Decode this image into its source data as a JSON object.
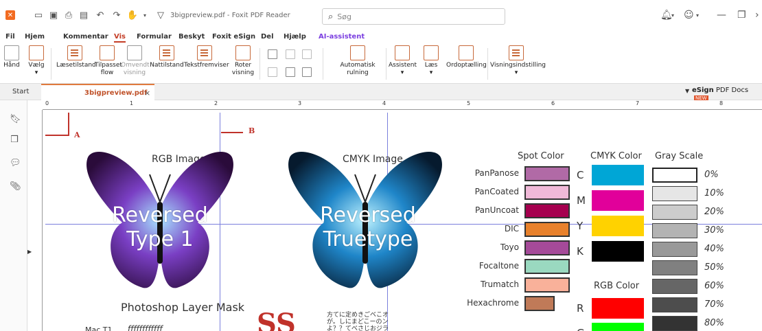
{
  "window": {
    "doc_title": "3bigpreview.pdf - Foxit PDF Reader",
    "search_placeholder": "Søg"
  },
  "menu": {
    "items": [
      "Fil",
      "Hjem",
      "Kommentar",
      "Vis",
      "Formular",
      "Beskyt",
      "Foxit eSign",
      "Del",
      "Hjælp",
      "AI-assistent"
    ],
    "active": "Vis"
  },
  "ribbon": {
    "hand": "Hånd",
    "select": "Vælg",
    "read_mode": "Læsetilstand",
    "fit_flow_1": "Tilpasset",
    "fit_flow_2": "flow",
    "reverse_1": "Omvendt",
    "reverse_2": "visning",
    "night": "Nattilstand",
    "text_viewer": "Tekstfremviser",
    "rotate_1": "Roter",
    "rotate_2": "visning",
    "autoscroll": "Automatisk rulning",
    "assistant": "Assistent",
    "read": "Læs",
    "word_count": "Ordoptælling",
    "view_settings": "Visningsindstilling"
  },
  "tabs": {
    "start": "Start",
    "doc": "3bigpreview.pdf",
    "close": "×",
    "esign_bold": "eSign",
    "esign_rest": "PDF Docs",
    "esign_badge": "NEW"
  },
  "ruler": {
    "h_numbers": [
      "0",
      "1",
      "2",
      "3",
      "4",
      "5",
      "6",
      "7",
      "8"
    ]
  },
  "page": {
    "mark_a": "A",
    "mark_b": "B",
    "rgb_caption": "RGB Image",
    "cmyk_caption": "CMYK Image",
    "bf1_line1": "Reversed",
    "bf1_line2": "Type 1",
    "bf2_line1": "Reversed",
    "bf2_line2": "Truetype",
    "photoshop": "Photoshop Layer Mask",
    "mac_t1": "Mac T1",
    "mac_t1_glyphs": "ƒƒƒƒƒƒƒƒƒƒƒƒ",
    "ss_logo": "SS",
    "cjk_text": "方てに定めきごべこオが。しにまどこーのンよ？？てべさじおジラ"
  },
  "colors": {
    "spot_head": "Spot Color",
    "cmyk_head": "CMYK Color",
    "gray_head": "Gray Scale",
    "rgb_head": "RGB Color",
    "spot": [
      {
        "label": "PanPanose",
        "color": "#b16aa6"
      },
      {
        "label": "PanCoated",
        "color": "#f0b9d8"
      },
      {
        "label": "PanUncoat",
        "color": "#a6004f"
      },
      {
        "label": "DIC",
        "color": "#e8812c"
      },
      {
        "label": "Toyo",
        "color": "#a54a99"
      },
      {
        "label": "Focaltone",
        "color": "#9ad9c0"
      },
      {
        "label": "Trumatch",
        "color": "#f9b19a"
      },
      {
        "label": "Hexachrome",
        "color": "#c07a58"
      }
    ],
    "cmyk": [
      {
        "label": "C",
        "color": "#00a6d6"
      },
      {
        "label": "M",
        "color": "#e1009a"
      },
      {
        "label": "Y",
        "color": "#ffd200"
      },
      {
        "label": "K",
        "color": "#000000"
      }
    ],
    "rgb": [
      {
        "label": "R",
        "color": "#ff0000"
      },
      {
        "label": "G",
        "color": "#00ff00"
      }
    ],
    "gray": [
      {
        "label": "0%",
        "color": "#ffffff"
      },
      {
        "label": "10%",
        "color": "#e6e6e6"
      },
      {
        "label": "20%",
        "color": "#cccccc"
      },
      {
        "label": "30%",
        "color": "#b3b3b3"
      },
      {
        "label": "40%",
        "color": "#999999"
      },
      {
        "label": "50%",
        "color": "#808080"
      },
      {
        "label": "60%",
        "color": "#666666"
      },
      {
        "label": "70%",
        "color": "#4d4d4d"
      },
      {
        "label": "80%",
        "color": "#333333"
      }
    ]
  }
}
